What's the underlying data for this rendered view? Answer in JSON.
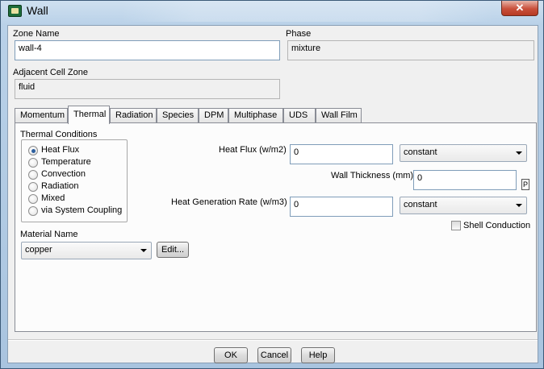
{
  "window": {
    "title": "Wall",
    "close_label": "✕"
  },
  "zone_name": {
    "label": "Zone Name",
    "value": "wall-4"
  },
  "phase": {
    "label": "Phase",
    "value": "mixture"
  },
  "adjacent_cell_zone": {
    "label": "Adjacent Cell Zone",
    "value": "fluid"
  },
  "tabs": [
    "Momentum",
    "Thermal",
    "Radiation",
    "Species",
    "DPM",
    "Multiphase",
    "UDS",
    "Wall Film"
  ],
  "active_tab": "Thermal",
  "thermal": {
    "conditions_label": "Thermal Conditions",
    "conditions": [
      "Heat Flux",
      "Temperature",
      "Convection",
      "Radiation",
      "Mixed",
      "via System Coupling"
    ],
    "selected_condition": "Heat Flux",
    "heat_flux": {
      "label": "Heat Flux (w/m2)",
      "value": "0",
      "method": "constant"
    },
    "wall_thickness": {
      "label": "Wall Thickness (mm)",
      "value": "0",
      "p_label": "P"
    },
    "heat_generation_rate": {
      "label": "Heat Generation Rate (w/m3)",
      "value": "0",
      "method": "constant"
    },
    "shell_conduction": {
      "label": "Shell Conduction",
      "checked": false
    },
    "material": {
      "label": "Material Name",
      "value": "copper",
      "edit_label": "Edit..."
    }
  },
  "buttons": {
    "ok": "OK",
    "cancel": "Cancel",
    "help": "Help"
  },
  "colors": {
    "title_gradient": "#b9d1e8",
    "close_button": "#c9503b",
    "radio_dot": "#2d5f9e"
  }
}
